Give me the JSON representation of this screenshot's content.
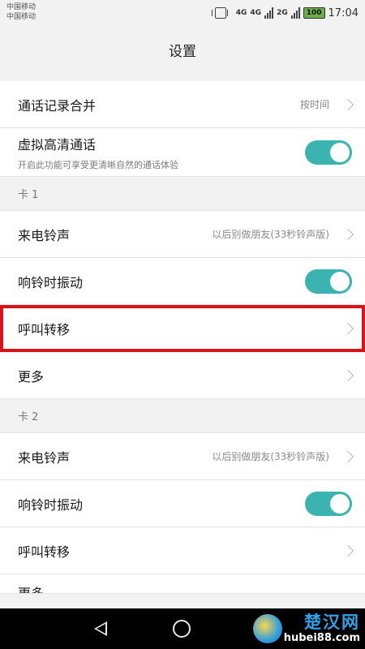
{
  "statusbar": {
    "carrier1": "中国移动",
    "carrier2": "中国移动",
    "net1": "4G",
    "net2": "4G",
    "net3": "2G",
    "battery": "100",
    "time": "17:04"
  },
  "header": {
    "title": "设置"
  },
  "rows": {
    "call_log_merge": {
      "label": "通话记录合并",
      "value": "按时间"
    },
    "hd_call": {
      "label": "虚拟高清通话",
      "sub": "开启此功能可享受更清晰自然的通话体验",
      "toggle_on": true
    },
    "card1_header": "卡 1",
    "card1_ringtone": {
      "label": "来电铃声",
      "value": "以后别做朋友(33秒铃声版)"
    },
    "card1_vibrate": {
      "label": "响铃时振动",
      "toggle_on": true
    },
    "card1_forward": {
      "label": "呼叫转移"
    },
    "card1_more": {
      "label": "更多"
    },
    "card2_header": "卡 2",
    "card2_ringtone": {
      "label": "来电铃声",
      "value": "以后别做朋友(33秒铃声版)"
    },
    "card2_vibrate": {
      "label": "响铃时振动",
      "toggle_on": true
    },
    "card2_forward": {
      "label": "呼叫转移"
    },
    "card2_more_partial": {
      "label": "更多"
    }
  },
  "watermark": {
    "name": "楚汉网",
    "url": "hubei88.com"
  },
  "colors": {
    "toggle_on": "#3bb3b0",
    "highlight": "#d8131a"
  },
  "icons": [
    "vibrate-icon",
    "signal-icon",
    "battery-icon",
    "chevron-right-icon",
    "back-icon",
    "home-icon",
    "watermark-logo-icon"
  ]
}
